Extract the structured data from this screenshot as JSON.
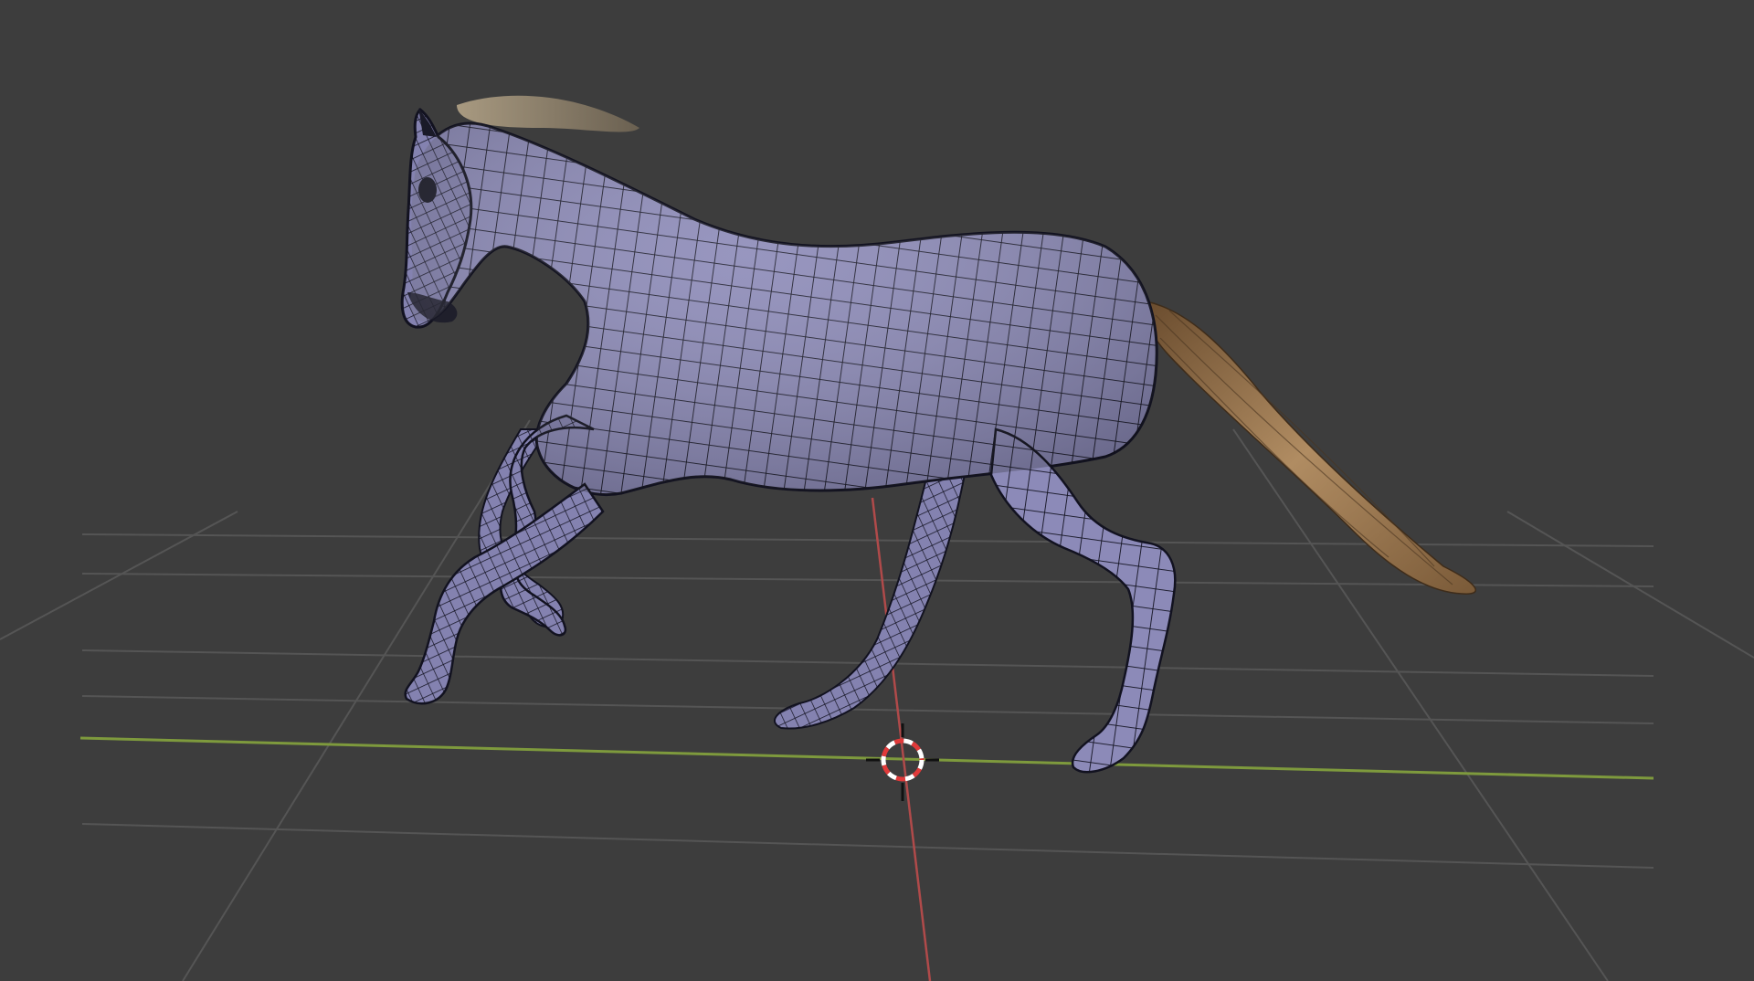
{
  "app": {
    "editor": "3D Viewport",
    "shading": "solid-wireframe"
  },
  "scene": {
    "object": "horse-mesh",
    "icons": {
      "cursor": "3d-cursor-icon"
    }
  },
  "colors": {
    "background": "#3d3d3d",
    "grid_line": "#555555",
    "x_axis": "#7e9a3d",
    "y_axis": "#b04a4a",
    "mesh_fill": "#8c8ab8",
    "mesh_wire": "#121220",
    "hair_light": "#b08c62",
    "hair_dark": "#5c4229",
    "cursor_red": "#e03a3a",
    "cursor_white": "#ffffff"
  }
}
